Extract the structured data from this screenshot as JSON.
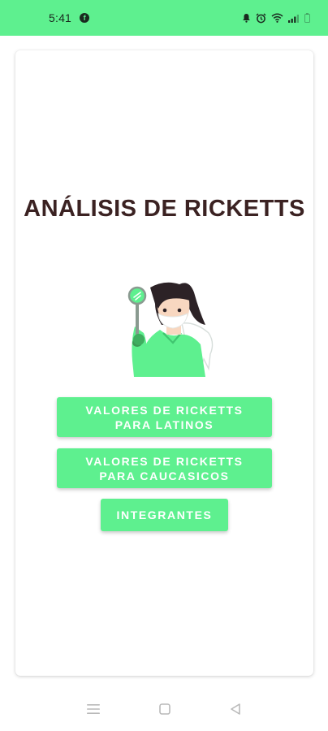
{
  "status_bar": {
    "time": "5:41",
    "facebook_icon": "facebook-icon",
    "icons": [
      "notification-icon",
      "alarm-icon",
      "wifi-icon",
      "signal-icon",
      "battery-icon"
    ],
    "background_color": "#5ef08f"
  },
  "main": {
    "title": "ANÁLISIS DE RICKETTS",
    "illustration_icon": "dentist-illustration-icon",
    "buttons": {
      "latinos": "VALORES DE RICKETTS\nPARA LATINOS",
      "caucasicos": "VALORES DE RICKETTS\nPARA CAUCASICOS",
      "integrantes": "INTEGRANTES"
    },
    "accent_color": "#5ef08f",
    "title_color": "#3b2222"
  },
  "navigation_bar": {
    "icons": [
      "menu-icon",
      "home-icon",
      "back-icon"
    ]
  }
}
